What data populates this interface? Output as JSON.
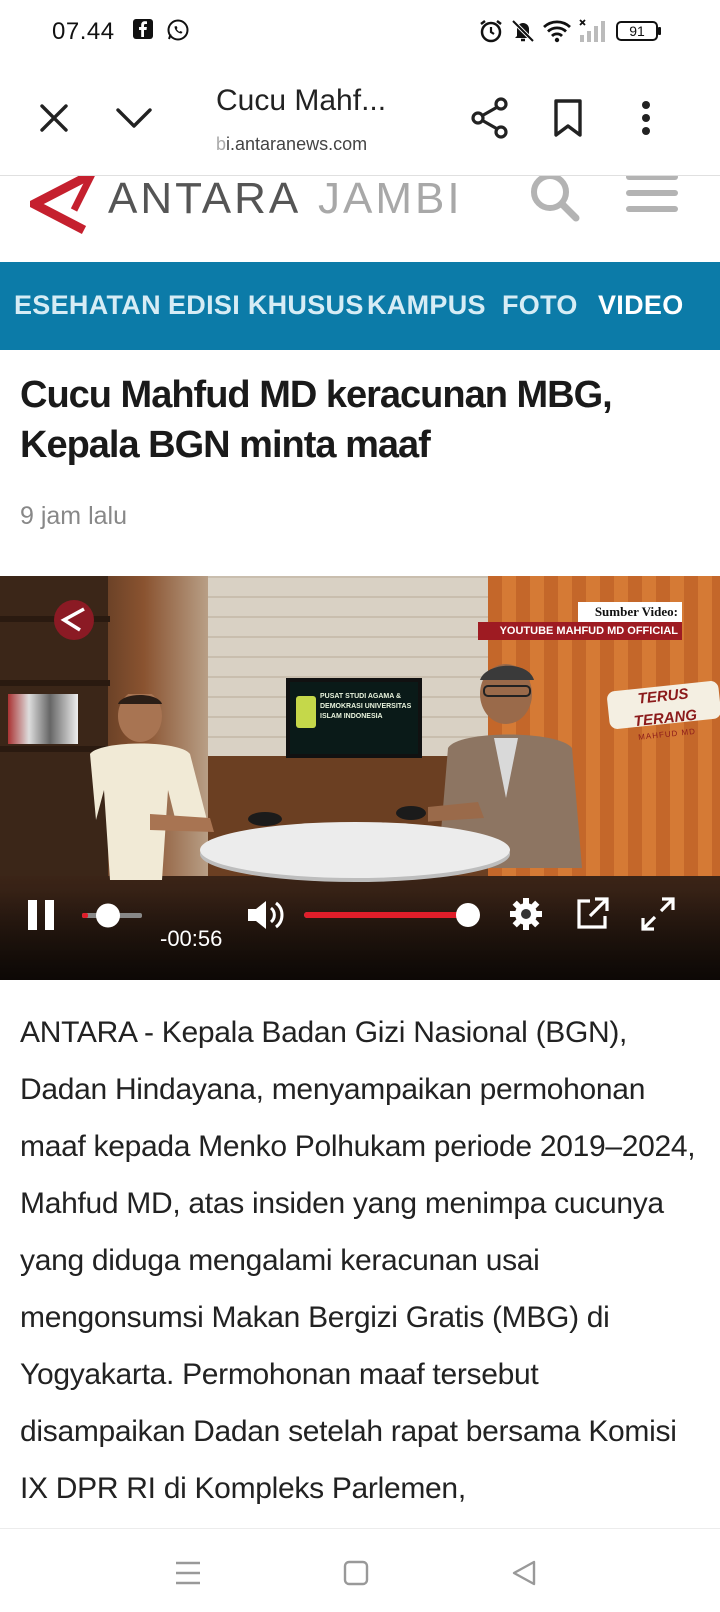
{
  "status_bar": {
    "time": "07.44",
    "battery": "91",
    "icons": [
      "facebook-icon",
      "whatsapp-icon",
      "alarm-icon",
      "mute-icon",
      "wifi-icon",
      "signal-icon",
      "battery-icon"
    ]
  },
  "browser": {
    "title": "Cucu Mahf...",
    "url": "i.antaranews.com",
    "buttons": [
      "close-icon",
      "chevron-down-icon",
      "share-icon",
      "bookmark-icon",
      "more-vert-icon"
    ]
  },
  "site": {
    "logo_main": "ANTARA",
    "logo_region": "JAMBI",
    "brand_color": "#c5202e",
    "nav_color": "#0c7ba8"
  },
  "nav": {
    "items": [
      "ESEHATAN",
      "EDISI KHUSUS",
      "KAMPUS",
      "FOTO",
      "VIDEO"
    ],
    "active": "VIDEO"
  },
  "article": {
    "headline": "Cucu Mahfud MD keracunan MBG, Kepala BGN minta maaf",
    "time_ago": "9 jam lalu",
    "body": "ANTARA - Kepala Badan Gizi Nasional (BGN), Dadan Hindayana, menyampaikan permohonan maaf kepada Menko Polhukam periode 2019–2024, Mahfud MD, atas insiden yang menimpa cucunya yang diduga mengalami keracunan usai mengonsumsi Makan Bergizi Gratis (MBG) di Yogyakarta. Permohonan maaf tersebut disampaikan Dadan setelah rapat bersama Komisi IX DPR RI di Kompleks Parlemen,"
  },
  "video": {
    "source_label": "Sumber Video:",
    "source_channel": "YOUTUBE MAHFUD MD OFFICIAL",
    "show_title": "TERUS TERANG",
    "show_subtitle": "MAHFUD MD",
    "tv_text": "PUSAT STUDI AGAMA & DEMOKRASI UNIVERSITAS ISLAM INDONESIA",
    "time_remaining": "-00:56",
    "progress": 0.1,
    "volume": 1.0,
    "controls": [
      "pause-icon",
      "volume-icon",
      "settings-icon",
      "external-open-icon",
      "fullscreen-icon"
    ]
  }
}
